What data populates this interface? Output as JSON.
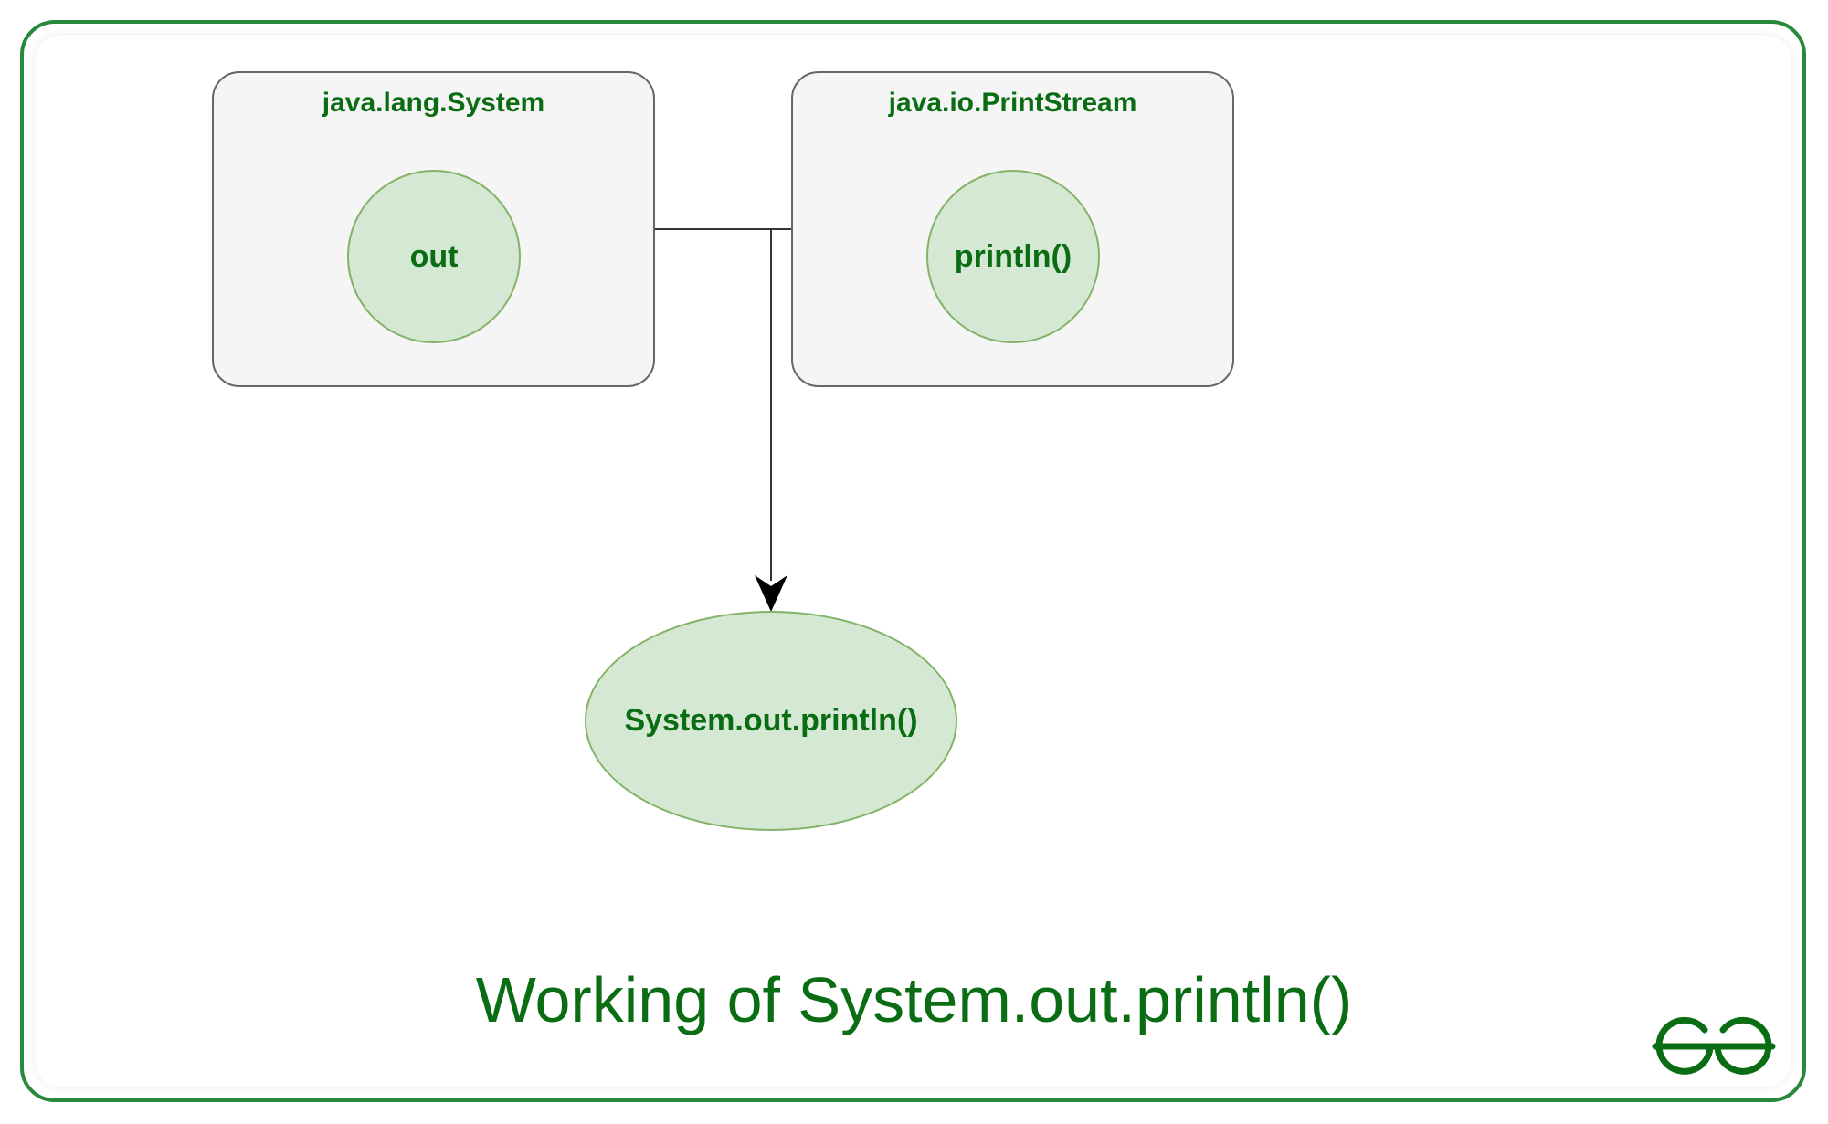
{
  "boxes": {
    "left": {
      "title": "java.lang.System",
      "circle_label": "out"
    },
    "right": {
      "title": "java.io.PrintStream",
      "circle_label": "println()"
    }
  },
  "result": {
    "label": "System.out.println()"
  },
  "title": "Working of System.out.println()",
  "colors": {
    "frame_border": "#268a3a",
    "text_green": "#0a6d14",
    "node_fill": "#d5e8d4",
    "node_stroke": "#82b366",
    "box_fill": "#f5f5f5",
    "box_stroke": "#666666"
  }
}
